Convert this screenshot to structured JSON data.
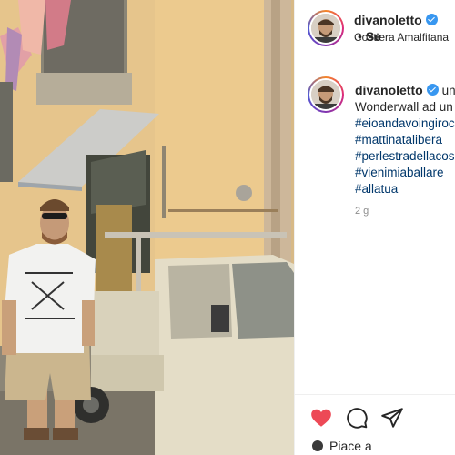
{
  "post": {
    "username": "divanoletto",
    "header_separator": "•",
    "header_follow": "Se",
    "location": "Costiera Amalfitana",
    "caption_first": "un",
    "caption_line2": "Wonderwall ad un",
    "hashtags": [
      "#eioandavoingiroc",
      "#mattinatalibera",
      "#perlestradellacos",
      "#vienimiaballare",
      "#allatua"
    ],
    "time": "2 g",
    "likes_text": "Piace a"
  },
  "icons": {
    "verified": "verified-badge-icon",
    "like": "heart-icon",
    "comment": "comment-icon",
    "share": "paper-plane-icon"
  },
  "colors": {
    "like": "#ed4956",
    "verified": "#3897f0",
    "hashtag": "#00376b",
    "secondary_text": "#8e8e8e"
  }
}
